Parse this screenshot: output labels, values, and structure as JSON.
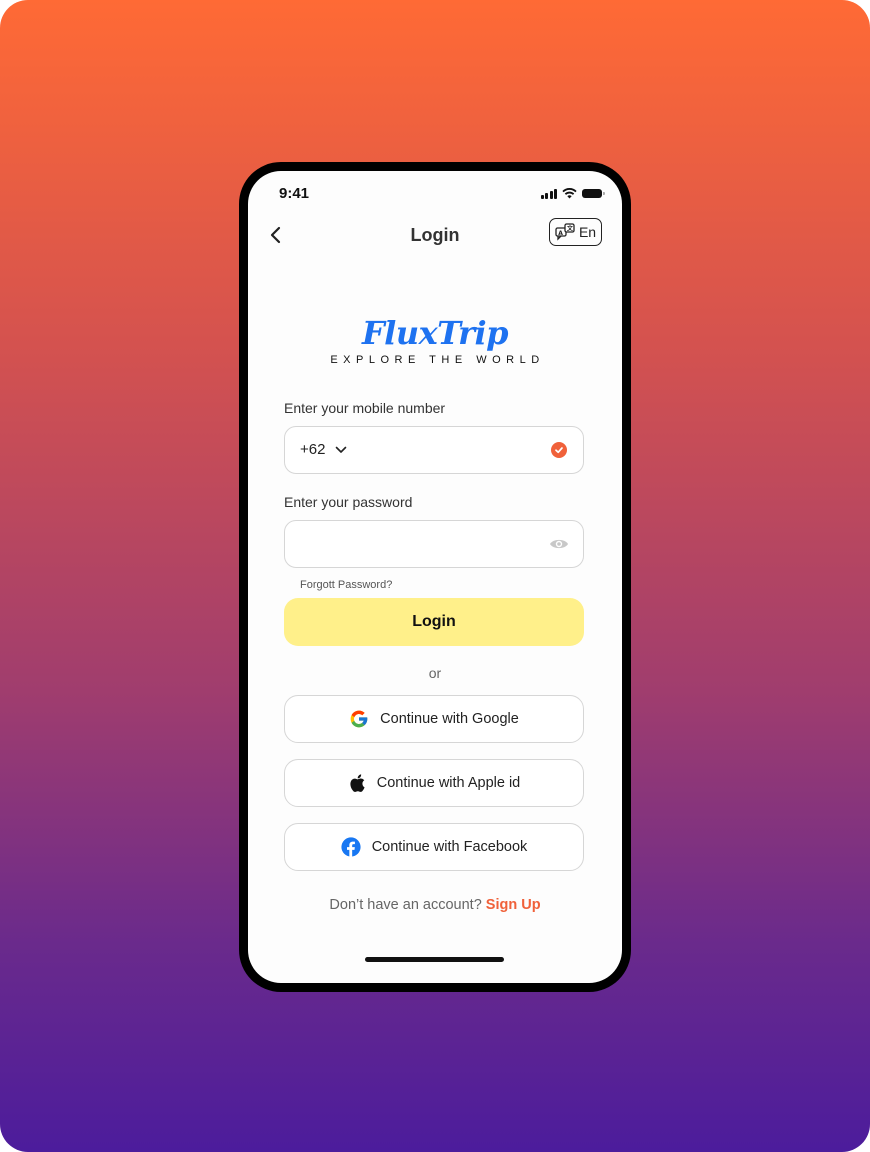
{
  "status_bar": {
    "time": "9:41"
  },
  "nav": {
    "title": "Login",
    "language_label": "En"
  },
  "brand": {
    "name": "FluxTrip",
    "tagline": "EXPLORE THE WORLD",
    "color": "#1e72f0"
  },
  "form": {
    "mobile": {
      "label": "Enter your mobile number",
      "country_code": "+62",
      "value": "",
      "verified": true
    },
    "password": {
      "label": "Enter your password",
      "value": ""
    },
    "forgot_label": "Forgott Password?",
    "login_label": "Login",
    "divider_label": "or"
  },
  "social": [
    {
      "label": "Continue with Google",
      "icon": "google-icon"
    },
    {
      "label": "Continue with Apple id",
      "icon": "apple-icon"
    },
    {
      "label": "Continue with Facebook",
      "icon": "facebook-icon"
    }
  ],
  "footer": {
    "prompt": "Don’t have an account?",
    "signup_label": "Sign Up"
  },
  "colors": {
    "accent": "#f0613a",
    "login_button": "#fff08a",
    "gradient_top": "#ff6a35",
    "gradient_bottom": "#4c1c9c"
  }
}
